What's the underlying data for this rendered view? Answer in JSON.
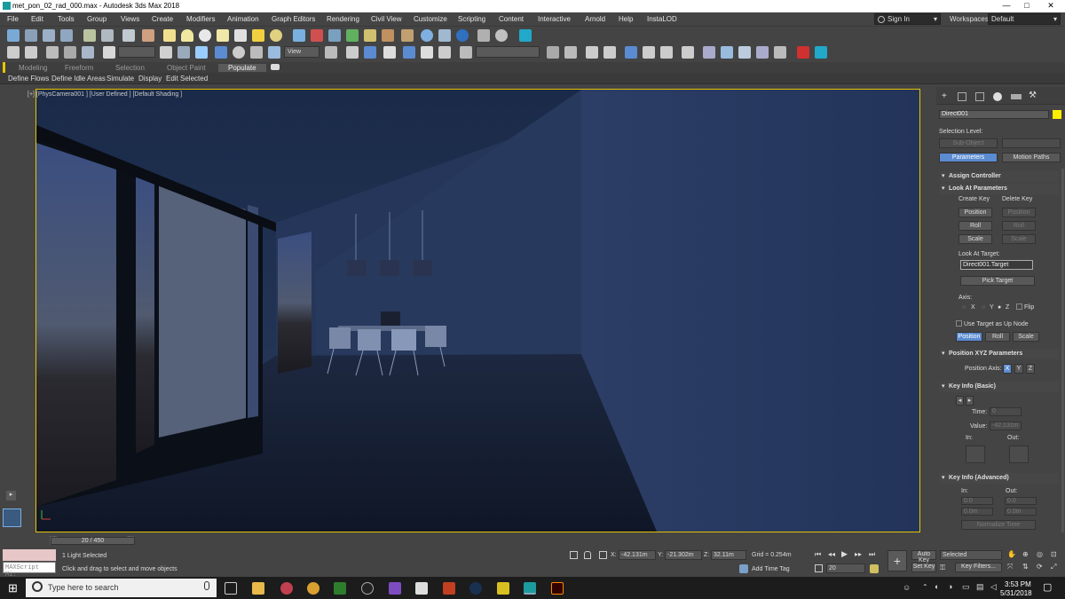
{
  "title": {
    "text": "met_pon_02_rad_000.max - Autodesk 3ds Max 2018",
    "min": "—",
    "max": "□",
    "close": "✕"
  },
  "menu": [
    "File",
    "Edit",
    "Tools",
    "Group",
    "Views",
    "Create",
    "Modifiers",
    "Animation",
    "Graph Editors",
    "Rendering",
    "Civil View",
    "Customize",
    "Scripting",
    "Content",
    "Interactive",
    "Arnold",
    "Help",
    "InstaLOD"
  ],
  "signin": "Sign In",
  "workspaces": {
    "label": "Workspaces:",
    "value": "Default"
  },
  "toolbar": {
    "view_dropdown": "View",
    "selection_set": ""
  },
  "ribbon": {
    "tabs": [
      "Modeling",
      "Freeform",
      "Selection",
      "Object Paint",
      "Populate"
    ],
    "active": "Populate"
  },
  "populate": [
    "Define Flows",
    "Define Idle Areas",
    "Simulate",
    "Display",
    "Edit Selected"
  ],
  "viewport": {
    "label": "[+] [PhysCamera001 ] [User Defined ] [Default Shading ]"
  },
  "command_panel": {
    "object_name": "Direct001",
    "object_color": "#ffee00",
    "selection_level": "Selection Level:",
    "sub_object": "Sub-Object",
    "parameters": "Parameters",
    "motion_paths": "Motion Paths",
    "assign_controller": "Assign Controller",
    "look_at": {
      "title": "Look At Parameters",
      "create_key": "Create Key",
      "delete_key": "Delete Key",
      "position": "Position",
      "roll": "Roll",
      "scale": "Scale",
      "target_label": "Look At Target:",
      "target_value": "Direct001.Target",
      "pick_target": "Pick Target",
      "axis_label": "Axis:",
      "axis_x": "X",
      "axis_y": "Y",
      "axis_z": "Z",
      "flip": "Flip",
      "use_target": "Use Target as Up Node"
    },
    "pos_xyz": {
      "title": "Position XYZ Parameters",
      "axis_label": "Position Axis:",
      "x": "X",
      "y": "Y",
      "z": "Z"
    },
    "key_info_basic": {
      "title": "Key Info (Basic)",
      "time_label": "Time:",
      "time_value": "0",
      "value_label": "Value:",
      "value": "-42.131m",
      "in_label": "In:",
      "out_label": "Out:"
    },
    "key_info_adv": {
      "title": "Key Info (Advanced)",
      "in_label": "In:",
      "out_label": "Out:",
      "in1": "0.0",
      "out1": "0.0",
      "in2": "0.0m",
      "out2": "0.0m",
      "normalize": "Normalize Time"
    }
  },
  "timeline": {
    "frame": "20 / 450",
    "prev": "<",
    "next": ">"
  },
  "status": {
    "maxscript": "MAXScript Mi:",
    "selected": "1 Light Selected",
    "prompt": "Click and drag to select and move objects",
    "x_label": "X:",
    "x": "-42.131m",
    "y_label": "Y:",
    "y": "-21.302m",
    "z_label": "Z:",
    "z": "32.11m",
    "grid": "Grid = 0.254m",
    "add_time_tag": "Add Time Tag",
    "frame_field": "20",
    "auto_key": "Auto Key",
    "set_key": "Set Key",
    "selected_dd": "Selected",
    "key_filters": "Key Filters..."
  },
  "taskbar": {
    "search": "Type here to search",
    "time": "3:53 PM",
    "date": "5/31/2018"
  }
}
